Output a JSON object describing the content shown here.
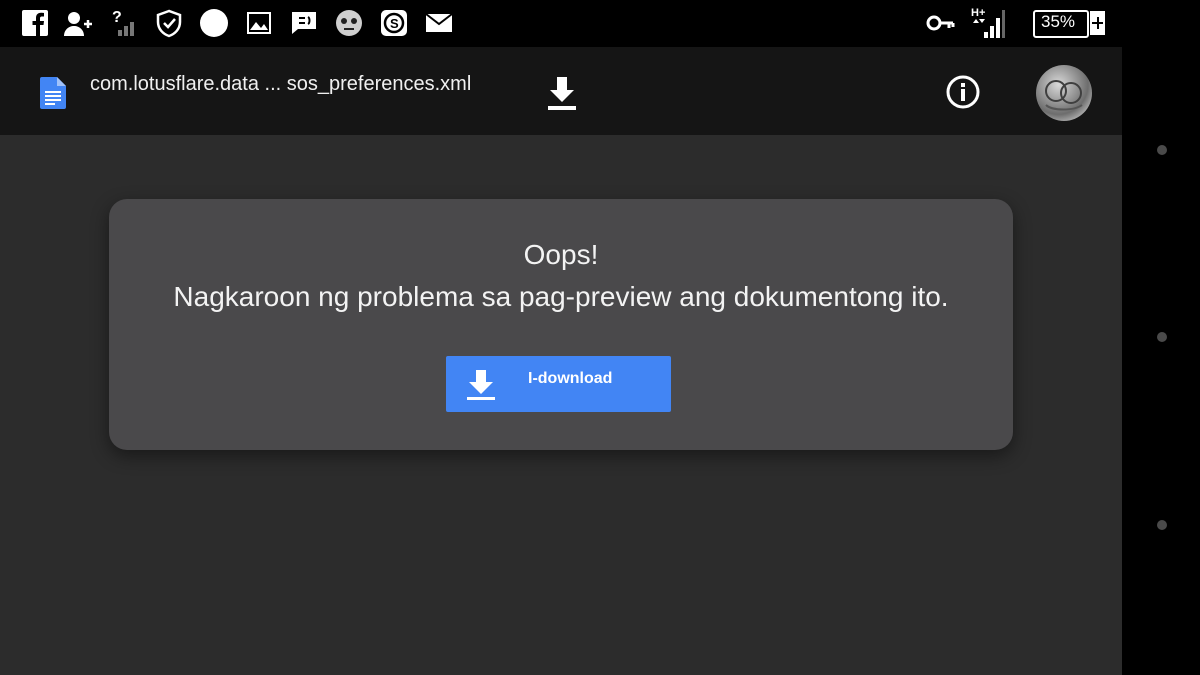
{
  "status_bar": {
    "battery_percent": "35%",
    "network_type": "H+",
    "icons": [
      "facebook-icon",
      "add-contact-icon",
      "no-signal-icon",
      "shield-icon",
      "circle-icon",
      "image-icon",
      "message-icon",
      "face-icon",
      "s-app-icon",
      "mail-icon",
      "key-icon",
      "signal-icon",
      "battery-icon"
    ]
  },
  "app_bar": {
    "file_name": "com.lotusflare.data ... sos_preferences.xml",
    "icons": [
      "doc-icon",
      "download-icon",
      "info-icon",
      "avatar"
    ]
  },
  "error_card": {
    "title": "Oops!",
    "message": "Nagkaroon ng problema sa pag-preview ang dokumentong ito.",
    "button_label": "I-download"
  },
  "colors": {
    "accent": "#4285f4",
    "card_bg": "#4a494b",
    "page_bg": "#2c2c2c",
    "app_bar_bg": "#151515",
    "status_bar_bg": "#000000"
  }
}
